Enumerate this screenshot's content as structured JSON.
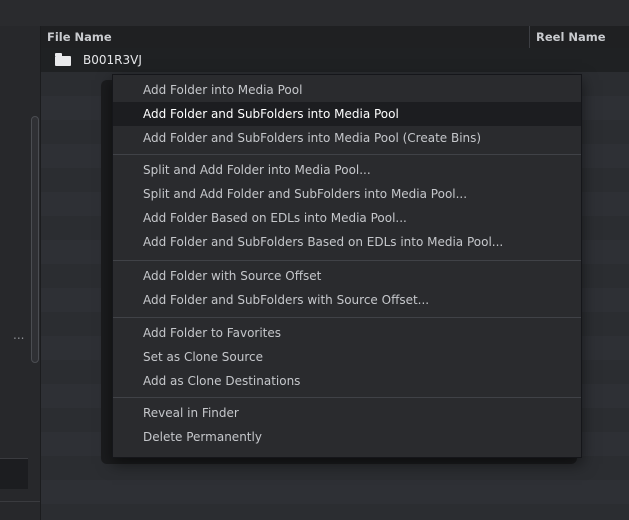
{
  "table": {
    "columns": [
      "File Name",
      "Reel Name"
    ],
    "folder": {
      "name": "B001R3VJ",
      "icon": "folder-icon"
    }
  },
  "left_panel": {
    "ellipsis": "..."
  },
  "context_menu": {
    "items": [
      "Add Folder into Media Pool",
      "Add Folder and SubFolders into Media Pool",
      "Add Folder and SubFolders into Media Pool (Create Bins)",
      "Split and Add Folder into Media Pool...",
      "Split and Add Folder and SubFolders into Media Pool...",
      "Add Folder Based on EDLs into Media Pool...",
      "Add Folder and SubFolders Based on EDLs into Media Pool...",
      "Add Folder with Source Offset",
      "Add Folder and SubFolders with Source Offset...",
      "Add Folder to Favorites",
      "Set as Clone Source",
      "Add as Clone Destinations",
      "Reveal in Finder",
      "Delete Permanently"
    ],
    "highlighted": "Add Folder and SubFolders into Media Pool"
  }
}
